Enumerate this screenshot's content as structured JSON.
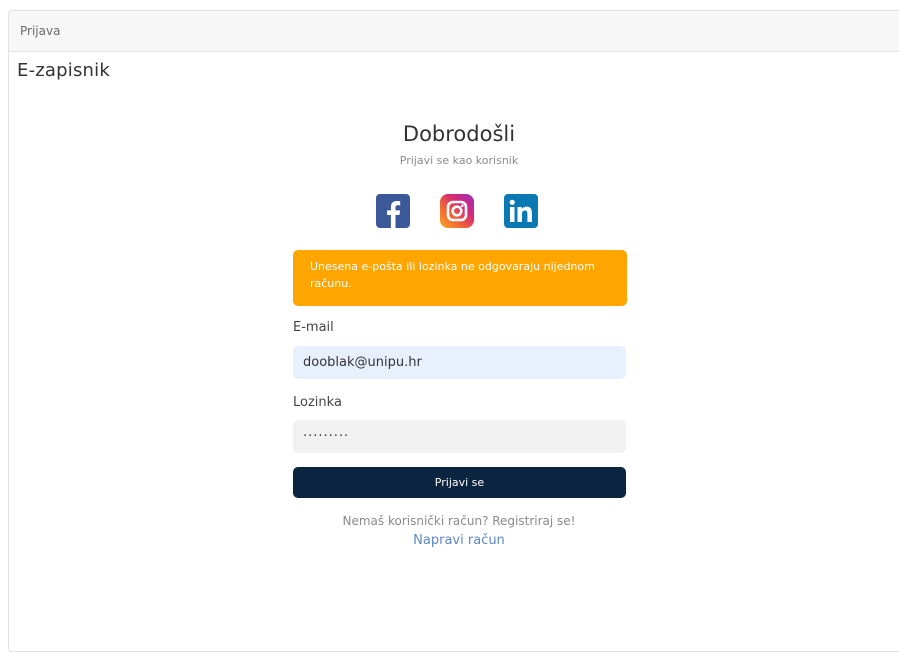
{
  "header": {
    "label": "Prijava"
  },
  "app": {
    "title": "E-zapisnik"
  },
  "login": {
    "welcome": "Dobrodošli",
    "subtitle": "Prijavi se kao korisnik",
    "social_icons": [
      "facebook-icon",
      "instagram-icon",
      "linkedin-icon"
    ],
    "alert": "Unesena e-pošta ili lozinka ne odgovaraju nijednom računu.",
    "email_label": "E-mail",
    "email_value": "dooblak@unipu.hr",
    "password_label": "Lozinka",
    "password_value": "·········",
    "submit_label": "Prijavi se",
    "register_text": "Nemaš korisnički račun? Registriraj se!",
    "register_link": "Napravi račun"
  },
  "colors": {
    "alert": "#ffa500",
    "button": "#0b2540",
    "email_bg": "#e8f0fe",
    "link": "#5e88c5"
  }
}
